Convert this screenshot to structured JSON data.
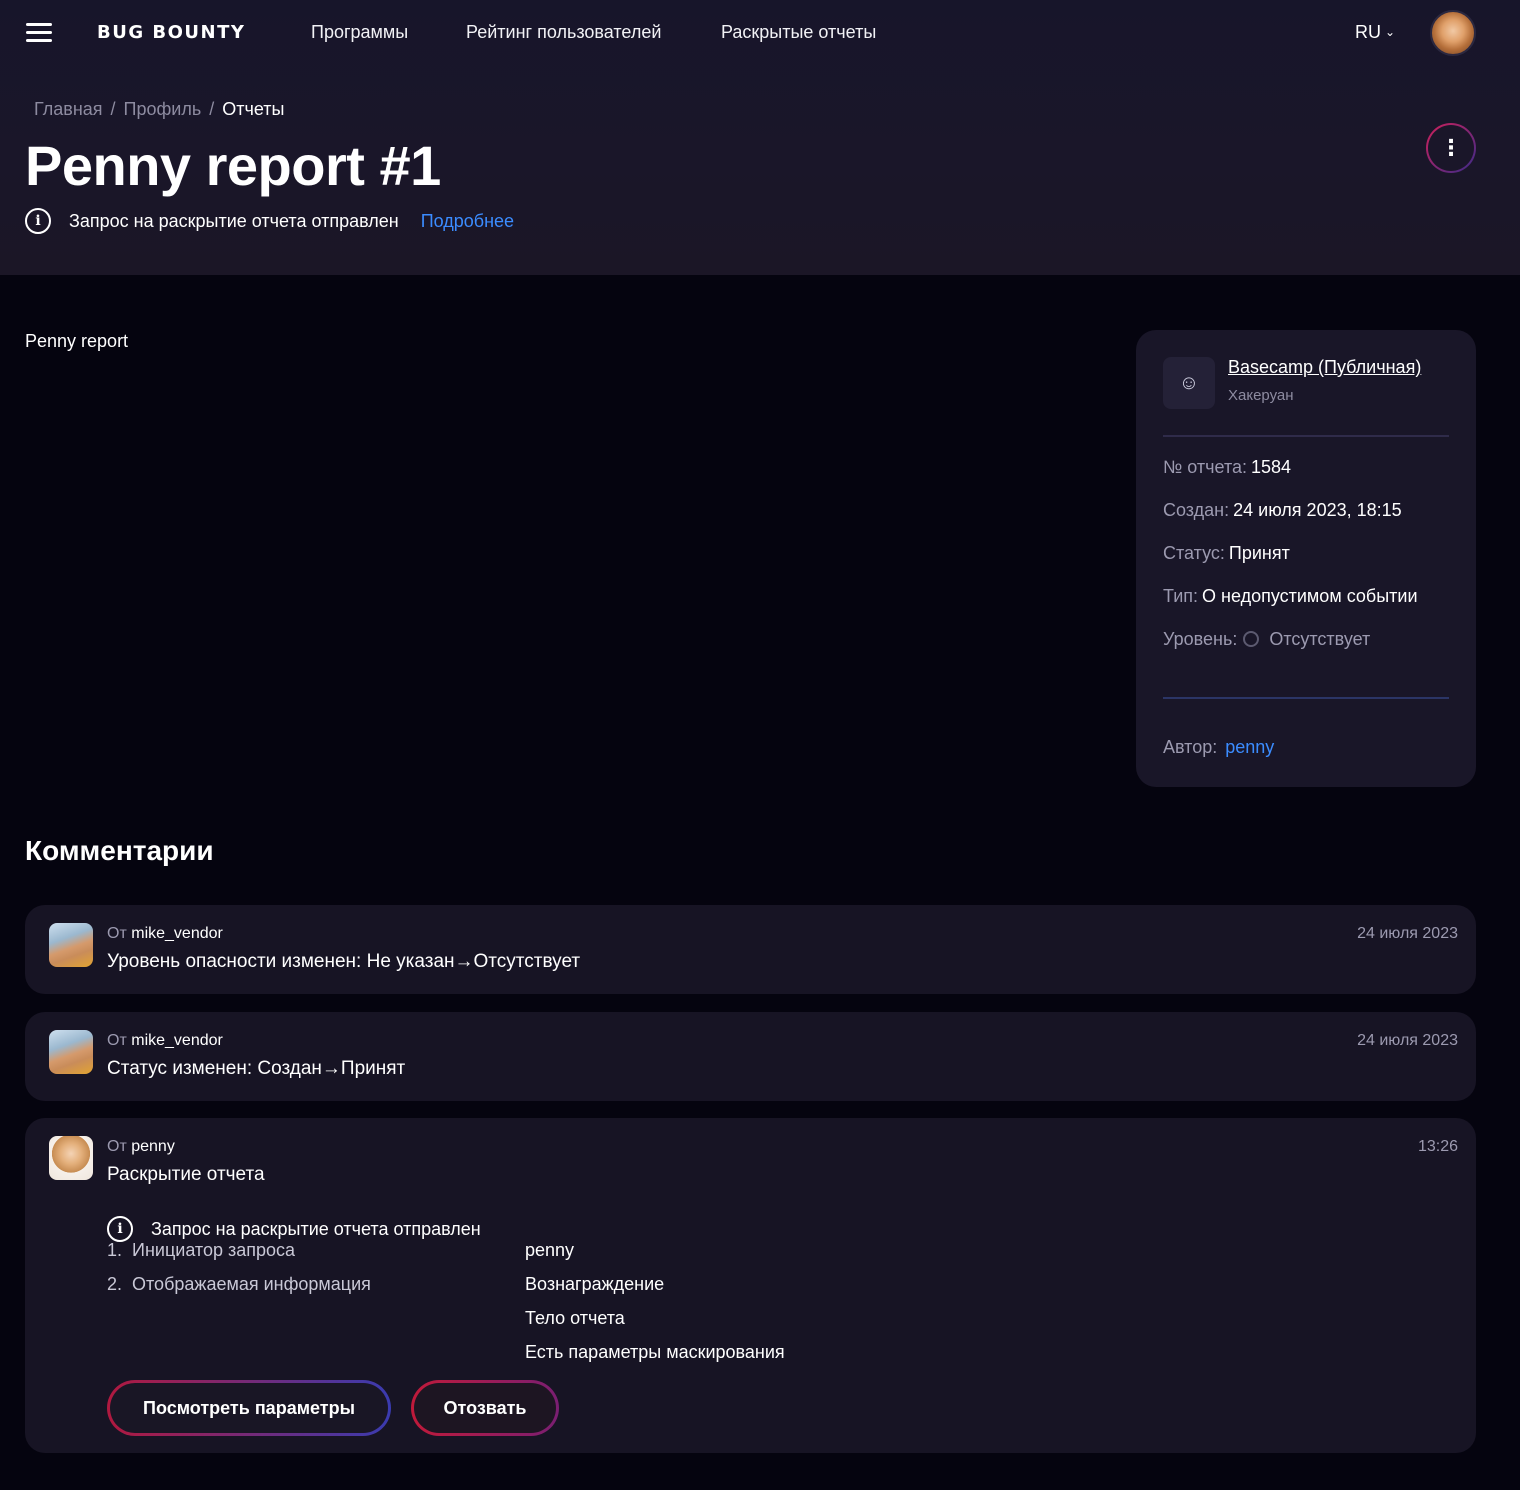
{
  "nav": {
    "logo": "BUG BOUNTY",
    "links": [
      "Программы",
      "Рейтинг пользователей",
      "Раскрытые отчеты"
    ],
    "lang": "RU"
  },
  "breadcrumb": [
    "Главная",
    "Профиль",
    "Отчеты"
  ],
  "title": "Penny report #1",
  "disclosure_notice": {
    "text": "Запрос на раскрытие отчета отправлен",
    "link": "Подробнее"
  },
  "description": "Penny report",
  "sidebar": {
    "program_name": "Basecamp (Публичная)",
    "program_sub": "Хакеруан",
    "rows": [
      {
        "label": "№ отчета:",
        "value": "1584"
      },
      {
        "label": "Создан:",
        "value": "24 июля 2023, 18:15"
      },
      {
        "label": "Статус:",
        "value": "Принят"
      },
      {
        "label": "Тип:",
        "value": "О недопустимом событии"
      },
      {
        "label": "Уровень:",
        "value": "Отсутствует"
      }
    ],
    "author_label": "Автор:",
    "author": "penny"
  },
  "comments_title": "Комментарии",
  "comments": [
    {
      "from_prefix": "От",
      "author": "mike_vendor",
      "text": "Уровень опасности изменен:  Не указан→Отсутствует",
      "date": "24 июля 2023"
    },
    {
      "from_prefix": "От",
      "author": "mike_vendor",
      "text": "Статус изменен:  Создан→Принят",
      "date": "24 июля 2023"
    },
    {
      "from_prefix": "От",
      "author": "penny",
      "text": "Раскрытие отчета",
      "date": "13:26",
      "info": "Запрос на раскрытие отчета отправлен",
      "items": [
        {
          "n": "1.",
          "label": "Инициатор запроса",
          "values": [
            "penny"
          ]
        },
        {
          "n": "2.",
          "label": "Отображаемая информация",
          "values": [
            "Вознаграждение",
            "Тело отчета",
            "Есть параметры маскирования"
          ]
        }
      ],
      "buttons": {
        "params": "Посмотреть параметры",
        "revoke": "Отозвать"
      }
    }
  ],
  "colors": {
    "background": "#05040f",
    "card": "#171424",
    "link": "#3b8cff",
    "accent_red": "#c01a3a"
  }
}
